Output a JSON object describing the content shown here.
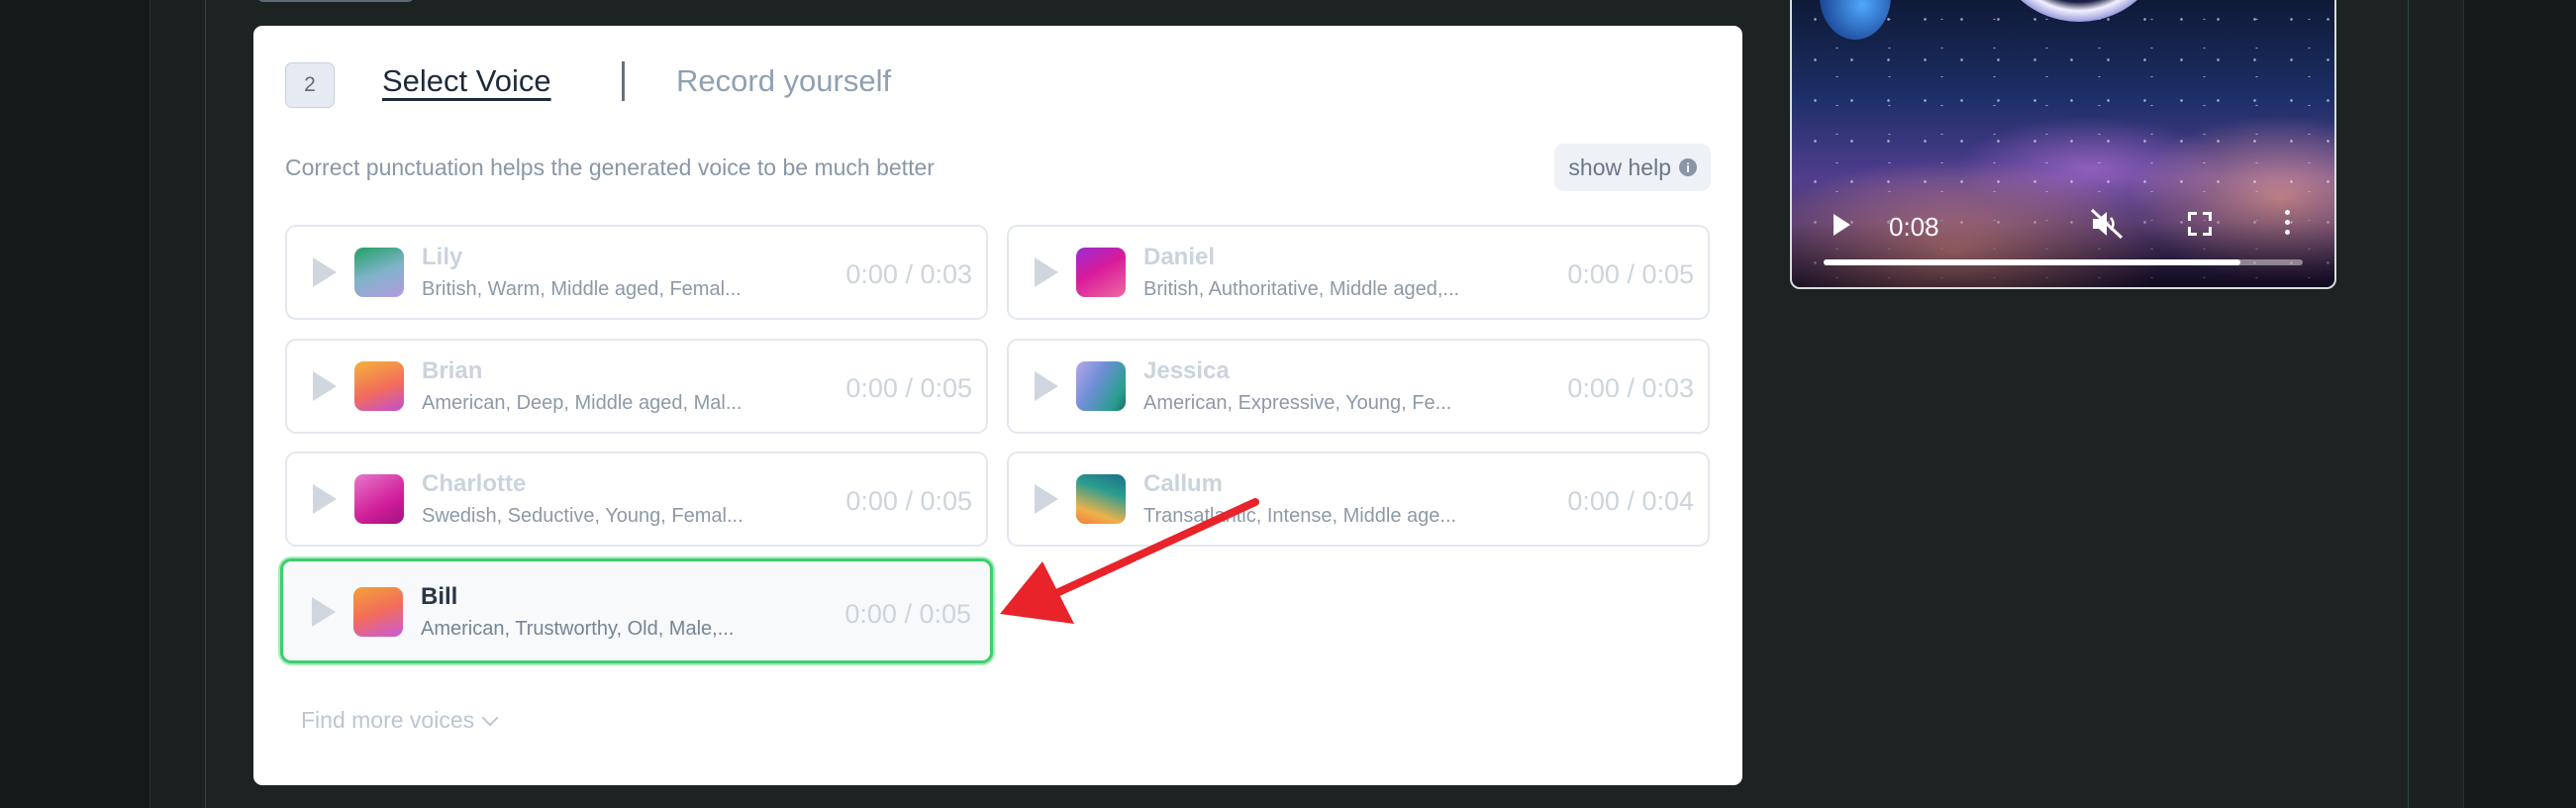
{
  "card": {
    "step_number": "2",
    "tab_select": "Select Voice",
    "tab_record": "Record yourself",
    "hint": "Correct punctuation helps the generated voice to be much better",
    "help_button": "show help",
    "find_more": "Find more voices"
  },
  "voices": [
    {
      "name": "Lily",
      "desc": "British, Warm, Middle aged, Femal...",
      "time": "0:00 / 0:03"
    },
    {
      "name": "Daniel",
      "desc": "British, Authoritative, Middle aged,...",
      "time": "0:00 / 0:05"
    },
    {
      "name": "Brian",
      "desc": "American, Deep, Middle aged, Mal...",
      "time": "0:00 / 0:05"
    },
    {
      "name": "Jessica",
      "desc": "American, Expressive, Young, Fe...",
      "time": "0:00 / 0:03"
    },
    {
      "name": "Charlotte",
      "desc": "Swedish, Seductive, Young, Femal...",
      "time": "0:00 / 0:05"
    },
    {
      "name": "Callum",
      "desc": "Transatlantic, Intense, Middle age...",
      "time": "0:00 / 0:04"
    },
    {
      "name": "Bill",
      "desc": "American, Trustworthy, Old, Male,...",
      "time": "0:00 / 0:05"
    }
  ],
  "selected_voice": "Bill",
  "video": {
    "time": "0:08",
    "progress": 0.87,
    "muted": true
  },
  "colors": {
    "accent_selected": "#3ccf6d",
    "annotation_arrow": "#e8232a"
  },
  "icons": [
    "play-icon",
    "info-icon",
    "chevron-down-icon",
    "mute-icon",
    "fullscreen-icon",
    "more-vert-icon"
  ]
}
